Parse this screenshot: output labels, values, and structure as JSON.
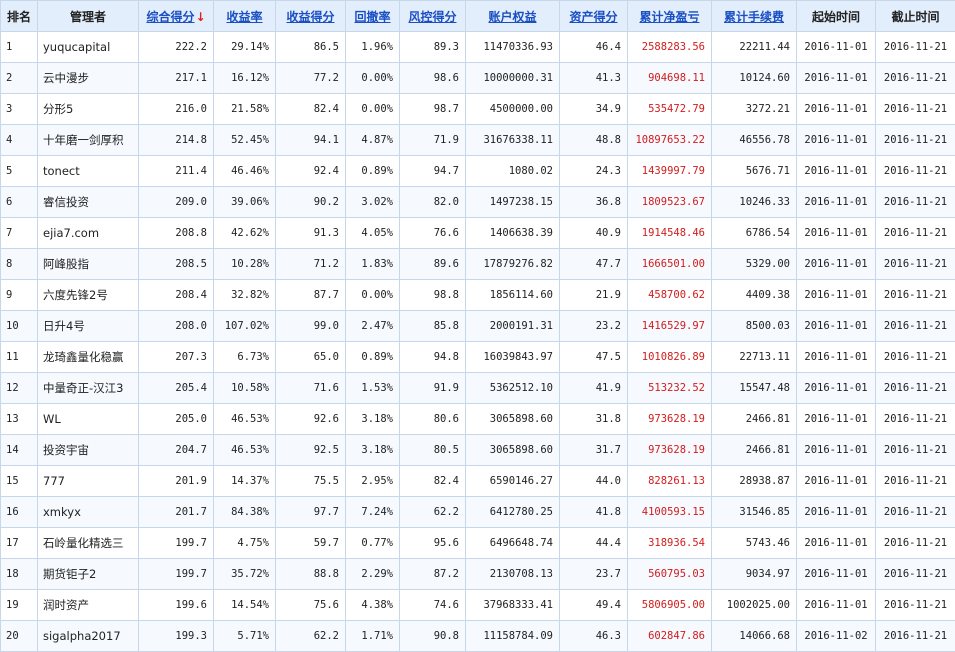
{
  "headers": {
    "rank": "排名",
    "manager": "管理者",
    "composite": "综合得分",
    "composite_arrow": "↓",
    "return_rate": "收益率",
    "return_score": "收益得分",
    "drawdown": "回撤率",
    "risk_score": "风控得分",
    "equity": "账户权益",
    "asset_score": "资产得分",
    "cum_pnl": "累计净盈亏",
    "cum_fee": "累计手续费",
    "start": "起始时间",
    "end": "截止时间"
  },
  "colors": {
    "header_bg": "#e3eefc",
    "link_blue": "#1a4fc4",
    "pnl_red": "#d21c1c",
    "sort_arrow_red": "#e02020",
    "grid_line": "#c6d7ec"
  },
  "rows": [
    {
      "rank": "1",
      "manager": "yuqucapital",
      "composite": "222.2",
      "return_rate": "29.14%",
      "return_score": "86.5",
      "drawdown": "1.96%",
      "risk_score": "89.3",
      "equity": "11470336.93",
      "asset_score": "46.4",
      "cum_pnl": "2588283.56",
      "cum_fee": "22211.44",
      "start": "2016-11-01",
      "end": "2016-11-21"
    },
    {
      "rank": "2",
      "manager": "云中漫步",
      "composite": "217.1",
      "return_rate": "16.12%",
      "return_score": "77.2",
      "drawdown": "0.00%",
      "risk_score": "98.6",
      "equity": "10000000.31",
      "asset_score": "41.3",
      "cum_pnl": "904698.11",
      "cum_fee": "10124.60",
      "start": "2016-11-01",
      "end": "2016-11-21"
    },
    {
      "rank": "3",
      "manager": "分形5",
      "composite": "216.0",
      "return_rate": "21.58%",
      "return_score": "82.4",
      "drawdown": "0.00%",
      "risk_score": "98.7",
      "equity": "4500000.00",
      "asset_score": "34.9",
      "cum_pnl": "535472.79",
      "cum_fee": "3272.21",
      "start": "2016-11-01",
      "end": "2016-11-21"
    },
    {
      "rank": "4",
      "manager": "十年磨一剑厚积",
      "composite": "214.8",
      "return_rate": "52.45%",
      "return_score": "94.1",
      "drawdown": "4.87%",
      "risk_score": "71.9",
      "equity": "31676338.11",
      "asset_score": "48.8",
      "cum_pnl": "10897653.22",
      "cum_fee": "46556.78",
      "start": "2016-11-01",
      "end": "2016-11-21"
    },
    {
      "rank": "5",
      "manager": "tonect",
      "composite": "211.4",
      "return_rate": "46.46%",
      "return_score": "92.4",
      "drawdown": "0.89%",
      "risk_score": "94.7",
      "equity": "1080.02",
      "asset_score": "24.3",
      "cum_pnl": "1439997.79",
      "cum_fee": "5676.71",
      "start": "2016-11-01",
      "end": "2016-11-21"
    },
    {
      "rank": "6",
      "manager": "睿信投资",
      "composite": "209.0",
      "return_rate": "39.06%",
      "return_score": "90.2",
      "drawdown": "3.02%",
      "risk_score": "82.0",
      "equity": "1497238.15",
      "asset_score": "36.8",
      "cum_pnl": "1809523.67",
      "cum_fee": "10246.33",
      "start": "2016-11-01",
      "end": "2016-11-21"
    },
    {
      "rank": "7",
      "manager": "ejia7.com",
      "composite": "208.8",
      "return_rate": "42.62%",
      "return_score": "91.3",
      "drawdown": "4.05%",
      "risk_score": "76.6",
      "equity": "1406638.39",
      "asset_score": "40.9",
      "cum_pnl": "1914548.46",
      "cum_fee": "6786.54",
      "start": "2016-11-01",
      "end": "2016-11-21"
    },
    {
      "rank": "8",
      "manager": "阿峰股指",
      "composite": "208.5",
      "return_rate": "10.28%",
      "return_score": "71.2",
      "drawdown": "1.83%",
      "risk_score": "89.6",
      "equity": "17879276.82",
      "asset_score": "47.7",
      "cum_pnl": "1666501.00",
      "cum_fee": "5329.00",
      "start": "2016-11-01",
      "end": "2016-11-21"
    },
    {
      "rank": "9",
      "manager": "六度先锋2号",
      "composite": "208.4",
      "return_rate": "32.82%",
      "return_score": "87.7",
      "drawdown": "0.00%",
      "risk_score": "98.8",
      "equity": "1856114.60",
      "asset_score": "21.9",
      "cum_pnl": "458700.62",
      "cum_fee": "4409.38",
      "start": "2016-11-01",
      "end": "2016-11-21"
    },
    {
      "rank": "10",
      "manager": "日升4号",
      "composite": "208.0",
      "return_rate": "107.02%",
      "return_score": "99.0",
      "drawdown": "2.47%",
      "risk_score": "85.8",
      "equity": "2000191.31",
      "asset_score": "23.2",
      "cum_pnl": "1416529.97",
      "cum_fee": "8500.03",
      "start": "2016-11-01",
      "end": "2016-11-21"
    },
    {
      "rank": "11",
      "manager": "龙琦鑫量化稳赢",
      "composite": "207.3",
      "return_rate": "6.73%",
      "return_score": "65.0",
      "drawdown": "0.89%",
      "risk_score": "94.8",
      "equity": "16039843.97",
      "asset_score": "47.5",
      "cum_pnl": "1010826.89",
      "cum_fee": "22713.11",
      "start": "2016-11-01",
      "end": "2016-11-21"
    },
    {
      "rank": "12",
      "manager": "中量奇正-汉江3",
      "composite": "205.4",
      "return_rate": "10.58%",
      "return_score": "71.6",
      "drawdown": "1.53%",
      "risk_score": "91.9",
      "equity": "5362512.10",
      "asset_score": "41.9",
      "cum_pnl": "513232.52",
      "cum_fee": "15547.48",
      "start": "2016-11-01",
      "end": "2016-11-21"
    },
    {
      "rank": "13",
      "manager": "WL",
      "composite": "205.0",
      "return_rate": "46.53%",
      "return_score": "92.6",
      "drawdown": "3.18%",
      "risk_score": "80.6",
      "equity": "3065898.60",
      "asset_score": "31.8",
      "cum_pnl": "973628.19",
      "cum_fee": "2466.81",
      "start": "2016-11-01",
      "end": "2016-11-21"
    },
    {
      "rank": "14",
      "manager": "投资宇宙",
      "composite": "204.7",
      "return_rate": "46.53%",
      "return_score": "92.5",
      "drawdown": "3.18%",
      "risk_score": "80.5",
      "equity": "3065898.60",
      "asset_score": "31.7",
      "cum_pnl": "973628.19",
      "cum_fee": "2466.81",
      "start": "2016-11-01",
      "end": "2016-11-21"
    },
    {
      "rank": "15",
      "manager": "777",
      "composite": "201.9",
      "return_rate": "14.37%",
      "return_score": "75.5",
      "drawdown": "2.95%",
      "risk_score": "82.4",
      "equity": "6590146.27",
      "asset_score": "44.0",
      "cum_pnl": "828261.13",
      "cum_fee": "28938.87",
      "start": "2016-11-01",
      "end": "2016-11-21"
    },
    {
      "rank": "16",
      "manager": "xmkyx",
      "composite": "201.7",
      "return_rate": "84.38%",
      "return_score": "97.7",
      "drawdown": "7.24%",
      "risk_score": "62.2",
      "equity": "6412780.25",
      "asset_score": "41.8",
      "cum_pnl": "4100593.15",
      "cum_fee": "31546.85",
      "start": "2016-11-01",
      "end": "2016-11-21"
    },
    {
      "rank": "17",
      "manager": "石岭量化精选三",
      "composite": "199.7",
      "return_rate": "4.75%",
      "return_score": "59.7",
      "drawdown": "0.77%",
      "risk_score": "95.6",
      "equity": "6496648.74",
      "asset_score": "44.4",
      "cum_pnl": "318936.54",
      "cum_fee": "5743.46",
      "start": "2016-11-01",
      "end": "2016-11-21"
    },
    {
      "rank": "18",
      "manager": "期货钜子2",
      "composite": "199.7",
      "return_rate": "35.72%",
      "return_score": "88.8",
      "drawdown": "2.29%",
      "risk_score": "87.2",
      "equity": "2130708.13",
      "asset_score": "23.7",
      "cum_pnl": "560795.03",
      "cum_fee": "9034.97",
      "start": "2016-11-01",
      "end": "2016-11-21"
    },
    {
      "rank": "19",
      "manager": "润时资产",
      "composite": "199.6",
      "return_rate": "14.54%",
      "return_score": "75.6",
      "drawdown": "4.38%",
      "risk_score": "74.6",
      "equity": "37968333.41",
      "asset_score": "49.4",
      "cum_pnl": "5806905.00",
      "cum_fee": "1002025.00",
      "start": "2016-11-01",
      "end": "2016-11-21"
    },
    {
      "rank": "20",
      "manager": "sigalpha2017",
      "composite": "199.3",
      "return_rate": "5.71%",
      "return_score": "62.2",
      "drawdown": "1.71%",
      "risk_score": "90.8",
      "equity": "11158784.09",
      "asset_score": "46.3",
      "cum_pnl": "602847.86",
      "cum_fee": "14066.68",
      "start": "2016-11-02",
      "end": "2016-11-21"
    }
  ]
}
